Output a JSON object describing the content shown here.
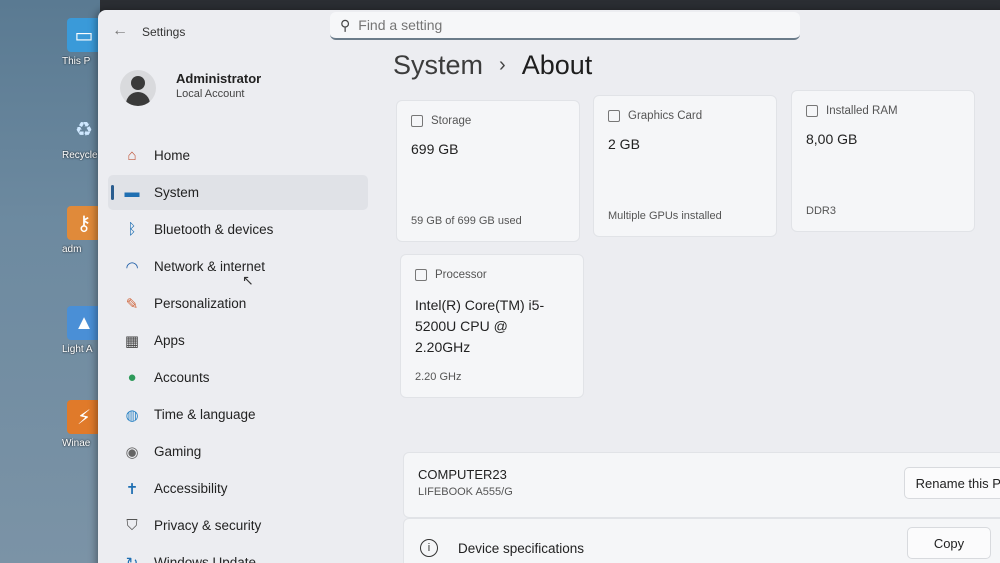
{
  "desktop": {
    "icons": [
      {
        "label": "This P",
        "icon": "monitor-icon"
      },
      {
        "label": "Recycle",
        "icon": "recycle-bin-icon"
      },
      {
        "label": "adm",
        "icon": "admin-tools-icon"
      },
      {
        "label": "Light A",
        "icon": "light-app-icon"
      },
      {
        "label": "Winae",
        "icon": "winaero-icon"
      }
    ]
  },
  "window": {
    "title": "Settings",
    "search_placeholder": "Find a setting"
  },
  "user": {
    "name": "Administrator",
    "account_type": "Local Account"
  },
  "nav": {
    "items": [
      {
        "label": "Home",
        "icon": "home-icon",
        "color": "#c0563a"
      },
      {
        "label": "System",
        "icon": "monitor-icon",
        "color": "#1f6fb2"
      },
      {
        "label": "Bluetooth & devices",
        "icon": "bluetooth-icon",
        "color": "#1f6fb2"
      },
      {
        "label": "Network & internet",
        "icon": "wifi-icon",
        "color": "#1f5ea8"
      },
      {
        "label": "Personalization",
        "icon": "brush-icon",
        "color": "#d0643a"
      },
      {
        "label": "Apps",
        "icon": "apps-icon",
        "color": "#444444"
      },
      {
        "label": "Accounts",
        "icon": "person-icon",
        "color": "#2e9a5a"
      },
      {
        "label": "Time & language",
        "icon": "globe-clock-icon",
        "color": "#2a83c4"
      },
      {
        "label": "Gaming",
        "icon": "gamepad-icon",
        "color": "#666666"
      },
      {
        "label": "Accessibility",
        "icon": "accessibility-icon",
        "color": "#1f6fb2"
      },
      {
        "label": "Privacy & security",
        "icon": "shield-icon",
        "color": "#555555"
      },
      {
        "label": "Windows Update",
        "icon": "update-icon",
        "color": "#1f6fb2"
      }
    ],
    "selected": "System"
  },
  "breadcrumb": {
    "parent": "System",
    "separator": "›",
    "current": "About"
  },
  "specs": {
    "storage": {
      "title": "Storage",
      "value": "699 GB",
      "detail": "59 GB of 699 GB used"
    },
    "graphics": {
      "title": "Graphics Card",
      "value": "2 GB",
      "detail": "Multiple GPUs installed"
    },
    "ram": {
      "title": "Installed RAM",
      "value": "8,00 GB",
      "detail": "DDR3"
    },
    "processor": {
      "title": "Processor",
      "value": "Intel(R) Core(TM) i5-5200U CPU @ 2.20GHz",
      "detail": "2.20 GHz"
    }
  },
  "device": {
    "name": "COMPUTER23",
    "model": "LIFEBOOK A555/G",
    "rename_label": "Rename this PC"
  },
  "device_specs": {
    "title": "Device specifications",
    "copy_label": "Copy"
  }
}
